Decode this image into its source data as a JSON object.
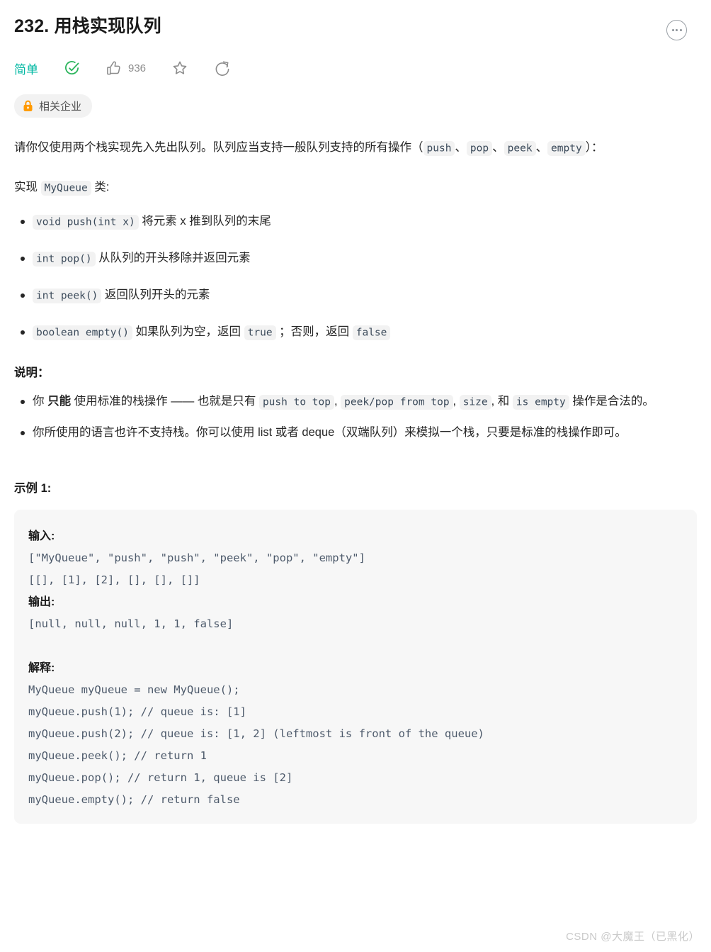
{
  "header": {
    "title": "232. 用栈实现队列",
    "more_icon": "more-horizontal-icon"
  },
  "meta": {
    "difficulty": "简单",
    "difficulty_color": "#00b8a3",
    "solved_icon": "check-circle-icon",
    "solved_color": "#2db55d",
    "like_icon": "thumbs-up-icon",
    "like_count": "936",
    "favorite_icon": "star-icon",
    "share_icon": "share-icon"
  },
  "tags": {
    "lock_icon": "lock-icon",
    "lock_color": "#f90",
    "company_label": "相关企业"
  },
  "description": {
    "intro_before": "请你仅使用两个栈实现先入先出队列。队列应当支持一般队列支持的所有操作（",
    "intro_codes": [
      "push",
      "pop",
      "peek",
      "empty"
    ],
    "intro_sep": "、",
    "intro_after": "）：",
    "implement_before": "实现 ",
    "implement_code": "MyQueue",
    "implement_after": " 类:"
  },
  "methods": [
    {
      "code": "void push(int x)",
      "text": "将元素 x 推到队列的末尾"
    },
    {
      "code": "int pop()",
      "text": "从队列的开头移除并返回元素"
    },
    {
      "code": "int peek()",
      "text": "返回队列开头的元素"
    },
    {
      "code": "boolean empty()",
      "text_1": "如果队列为空，返回 ",
      "code_true": "true",
      "text_2": " ；否则，返回 ",
      "code_false": "false"
    }
  ],
  "notes": {
    "heading": "说明：",
    "item1": {
      "part1": "你 ",
      "bold": "只能",
      "part2": " 使用标准的栈操作 —— 也就是只有 ",
      "code1": "push to top",
      "sep1": ", ",
      "code2": "peek/pop from top",
      "sep2": ", ",
      "code3": "size",
      "sep3": ", 和 ",
      "code4": "is empty",
      "part3": " 操作是合法的。"
    },
    "item2": "你所使用的语言也许不支持栈。你可以使用 list 或者 deque（双端队列）来模拟一个栈，只要是标准的栈操作即可。"
  },
  "example": {
    "heading": "示例 1:",
    "input_label": "输入:",
    "input_lines": [
      "[\"MyQueue\", \"push\", \"push\", \"peek\", \"pop\", \"empty\"]",
      "[[], [1], [2], [], [], []]"
    ],
    "output_label": "输出:",
    "output_lines": [
      "[null, null, null, 1, 1, false]"
    ],
    "explain_label": "解释:",
    "explain_lines": [
      "MyQueue myQueue = new MyQueue();",
      "myQueue.push(1); // queue is: [1]",
      "myQueue.push(2); // queue is: [1, 2] (leftmost is front of the queue)",
      "myQueue.peek(); // return 1",
      "myQueue.pop(); // return 1, queue is [2]",
      "myQueue.empty(); // return false"
    ]
  },
  "watermark": "CSDN @大魔王（已黑化）"
}
